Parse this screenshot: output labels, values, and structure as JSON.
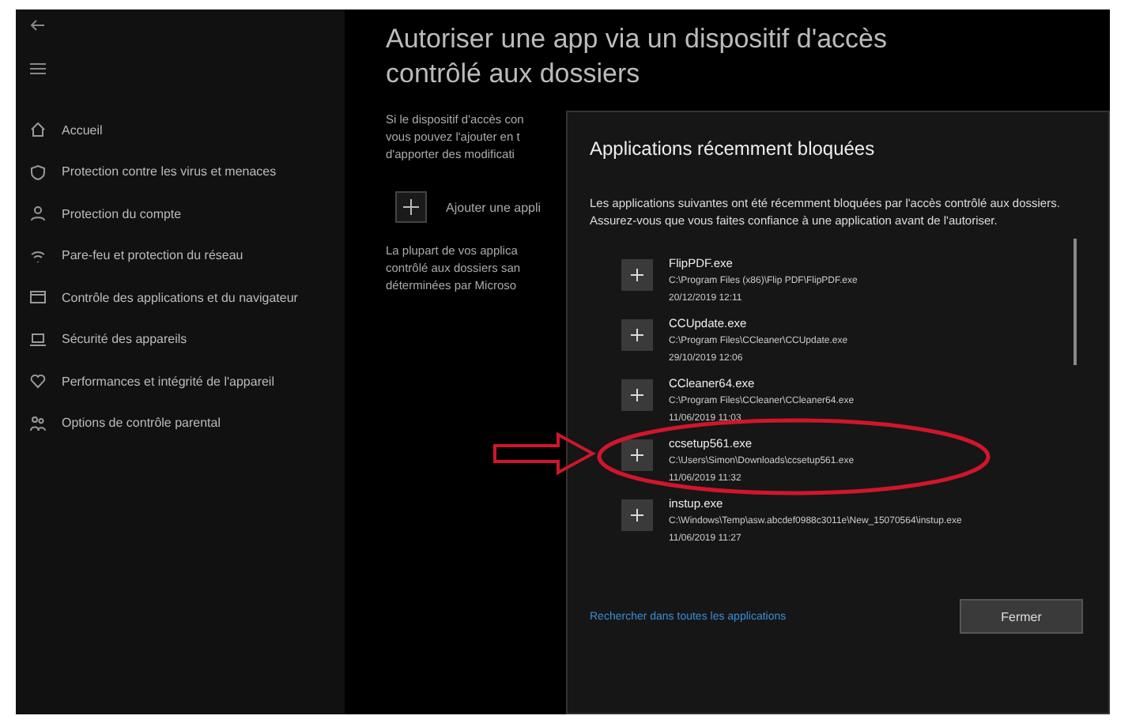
{
  "sidebar": {
    "items": [
      {
        "label": "Accueil"
      },
      {
        "label": "Protection contre les virus et menaces"
      },
      {
        "label": "Protection du compte"
      },
      {
        "label": "Pare-feu et protection du réseau"
      },
      {
        "label": "Contrôle des applications et du navigateur"
      },
      {
        "label": "Sécurité des appareils"
      },
      {
        "label": "Performances et intégrité de l'appareil"
      },
      {
        "label": "Options de contrôle parental"
      }
    ]
  },
  "main": {
    "title": "Autoriser une app via un dispositif d'accès contrôlé aux dossiers",
    "intro_lines": [
      "Si le dispositif d'accès con",
      "vous pouvez l'ajouter en t",
      "d'apporter des modificati"
    ],
    "add_button": "Ajouter une appli",
    "note_lines": [
      "La plupart de vos applica",
      "contrôlé aux dossiers san",
      "déterminées par Microso"
    ]
  },
  "dialog": {
    "title": "Applications récemment bloquées",
    "description": "Les applications suivantes ont été récemment bloquées par l'accès contrôlé aux dossiers. Assurez-vous que vous faites confiance à une application avant de l'autoriser.",
    "apps": [
      {
        "name": "FlipPDF.exe",
        "path": "C:\\Program Files (x86)\\Flip PDF\\FlipPDF.exe",
        "date": "20/12/2019 12:11",
        "highlighted": false
      },
      {
        "name": "CCUpdate.exe",
        "path": "C:\\Program Files\\CCleaner\\CCUpdate.exe",
        "date": "29/10/2019 12:06",
        "highlighted": false
      },
      {
        "name": "CCleaner64.exe",
        "path": "C:\\Program Files\\CCleaner\\CCleaner64.exe",
        "date": "11/06/2019 11:03",
        "highlighted": false
      },
      {
        "name": "ccsetup561.exe",
        "path": "C:\\Users\\Simon\\Downloads\\ccsetup561.exe",
        "date": "11/06/2019 11:32",
        "highlighted": true
      },
      {
        "name": "instup.exe",
        "path": "C:\\Windows\\Temp\\asw.abcdef0988c3011e\\New_15070564\\instup.exe",
        "date": "11/06/2019 11:27",
        "highlighted": false
      }
    ],
    "link": "Rechercher dans toutes les applications",
    "close_button": "Fermer"
  }
}
